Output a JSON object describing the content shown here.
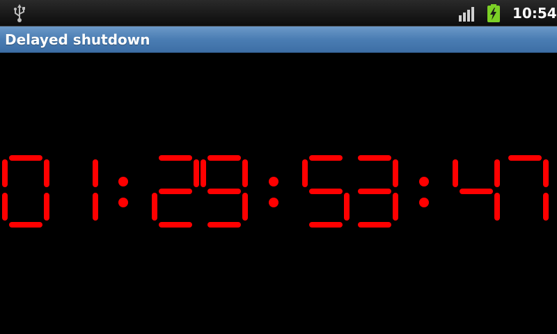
{
  "status_bar": {
    "time": "10:54",
    "icons": [
      "usb-icon",
      "signal-icon",
      "battery-charging-icon"
    ],
    "battery_color": "#7cd026"
  },
  "title_bar": {
    "title": "Delayed shutdown"
  },
  "timer": {
    "text": "01:29:53:47",
    "segment_color": "#ff0000"
  }
}
